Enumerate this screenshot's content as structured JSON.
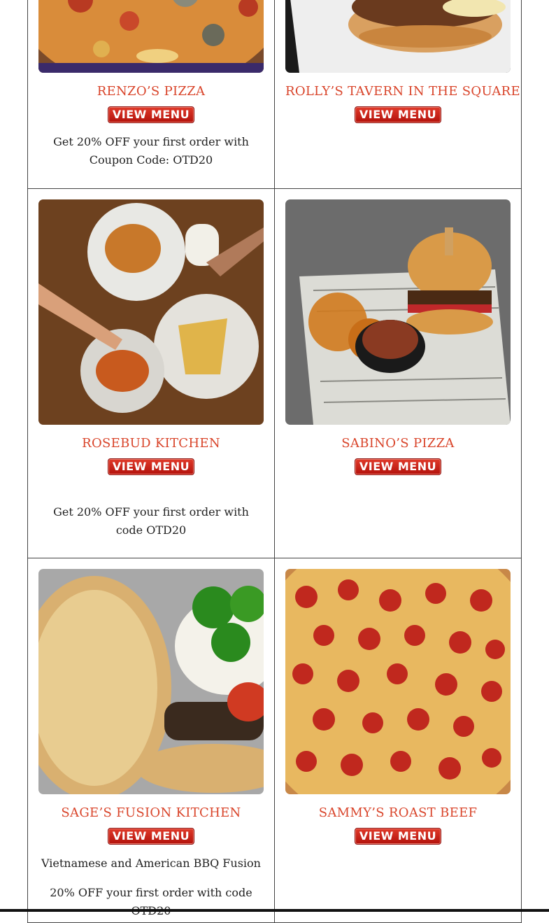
{
  "button_label": "VIEW MENU",
  "restaurants": [
    {
      "name": "RENZO’S PIZZA",
      "photo_icon": "pizza-photo",
      "desc": [
        "Get 20% OFF your first order with Coupon Code: OTD20"
      ]
    },
    {
      "name": "ROLLY’S TAVERN IN THE SQUARE",
      "photo_icon": "burger-photo",
      "desc": []
    },
    {
      "name": "ROSEBUD KITCHEN",
      "photo_icon": "table-spread-photo",
      "desc": [
        "Get 20% OFF your first order with code OTD20"
      ]
    },
    {
      "name": "SABINO’S PIZZA",
      "photo_icon": "burger-fries-photo",
      "desc": []
    },
    {
      "name": "SAGE’S FUSION KITCHEN",
      "photo_icon": "burger-jalapeno-photo",
      "desc": [
        "Vietnamese and American BBQ Fusion",
        "20% OFF your first order with code OTD20"
      ]
    },
    {
      "name": "SAMMY’S ROAST BEEF",
      "photo_icon": "pepperoni-pizza-photo",
      "desc": []
    }
  ],
  "colors": {
    "accent": "#d9452b",
    "button": "#c01d14"
  }
}
